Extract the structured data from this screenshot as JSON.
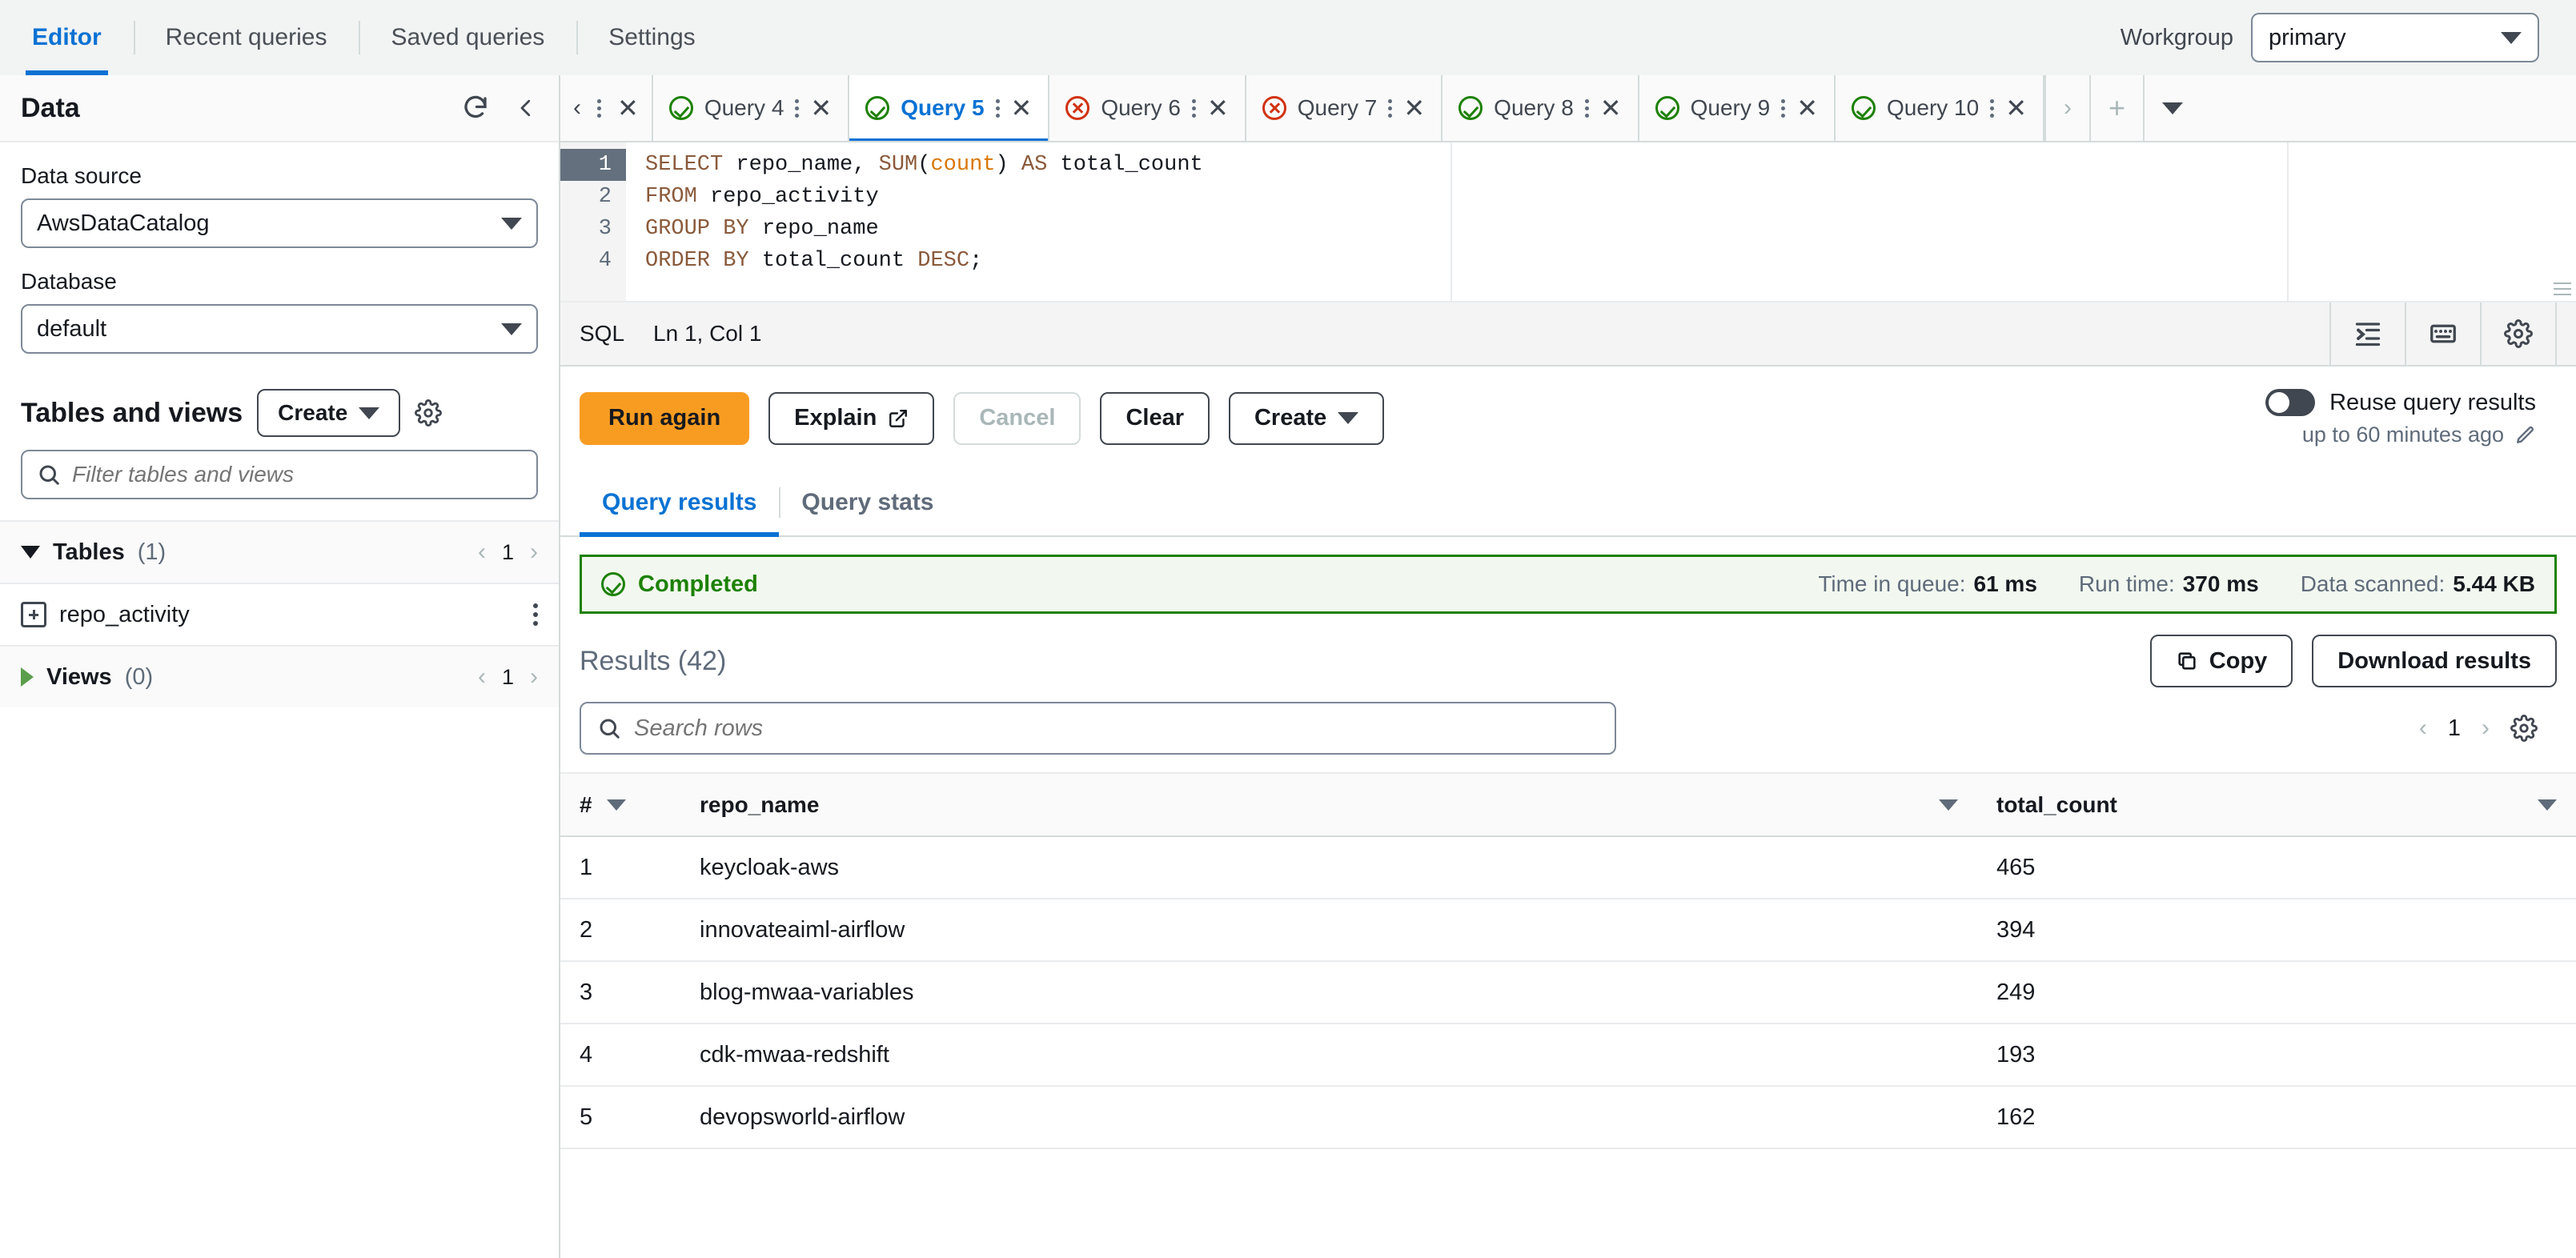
{
  "topnav": {
    "tabs": [
      {
        "label": "Editor",
        "active": true
      },
      {
        "label": "Recent queries",
        "active": false
      },
      {
        "label": "Saved queries",
        "active": false
      },
      {
        "label": "Settings",
        "active": false
      }
    ],
    "workgroup_label": "Workgroup",
    "workgroup_value": "primary"
  },
  "sidebar": {
    "title": "Data",
    "data_source_label": "Data source",
    "data_source_value": "AwsDataCatalog",
    "database_label": "Database",
    "database_value": "default",
    "tables_views_title": "Tables and views",
    "create_label": "Create",
    "filter_placeholder": "Filter tables and views",
    "tables_group": {
      "name": "Tables",
      "count": "(1)",
      "page": "1"
    },
    "tables": [
      {
        "name": "repo_activity"
      }
    ],
    "views_group": {
      "name": "Views",
      "count": "(0)",
      "page": "1"
    }
  },
  "query_tabs": [
    {
      "label": "Query 4",
      "status": "ok",
      "active": false
    },
    {
      "label": "Query 5",
      "status": "ok",
      "active": true
    },
    {
      "label": "Query 6",
      "status": "err",
      "active": false
    },
    {
      "label": "Query 7",
      "status": "err",
      "active": false
    },
    {
      "label": "Query 8",
      "status": "ok",
      "active": false
    },
    {
      "label": "Query 9",
      "status": "ok",
      "active": false
    },
    {
      "label": "Query 10",
      "status": "ok",
      "active": false
    }
  ],
  "editor": {
    "line_numbers": [
      "1",
      "2",
      "3",
      "4"
    ],
    "sql_lines": [
      "SELECT repo_name, SUM(count) AS total_count",
      "FROM repo_activity",
      "GROUP BY repo_name",
      "ORDER BY total_count DESC;"
    ],
    "language": "SQL",
    "cursor": "Ln 1, Col 1"
  },
  "actions": {
    "run_label": "Run again",
    "explain_label": "Explain",
    "cancel_label": "Cancel",
    "clear_label": "Clear",
    "create_label": "Create",
    "reuse_label": "Reuse query results",
    "reuse_sub": "up to 60 minutes ago",
    "reuse_on": false
  },
  "result_tabs": [
    {
      "label": "Query results",
      "active": true
    },
    {
      "label": "Query stats",
      "active": false
    }
  ],
  "status": {
    "state": "Completed",
    "metrics": [
      {
        "label": "Time in queue:",
        "value": "61 ms"
      },
      {
        "label": "Run time:",
        "value": "370 ms"
      },
      {
        "label": "Data scanned:",
        "value": "5.44 KB"
      }
    ]
  },
  "results": {
    "title": "Results",
    "count": "(42)",
    "copy_label": "Copy",
    "download_label": "Download results",
    "search_placeholder": "Search rows",
    "page": "1",
    "columns": [
      "#",
      "repo_name",
      "total_count"
    ],
    "rows": [
      {
        "idx": "1",
        "repo_name": "keycloak-aws",
        "total_count": "465"
      },
      {
        "idx": "2",
        "repo_name": "innovateaiml-airflow",
        "total_count": "394"
      },
      {
        "idx": "3",
        "repo_name": "blog-mwaa-variables",
        "total_count": "249"
      },
      {
        "idx": "4",
        "repo_name": "cdk-mwaa-redshift",
        "total_count": "193"
      },
      {
        "idx": "5",
        "repo_name": "devopsworld-airflow",
        "total_count": "162"
      }
    ]
  },
  "colors": {
    "accent": "#0972d3",
    "primary_button": "#f89c21",
    "success": "#1d8102",
    "error": "#d13212"
  }
}
